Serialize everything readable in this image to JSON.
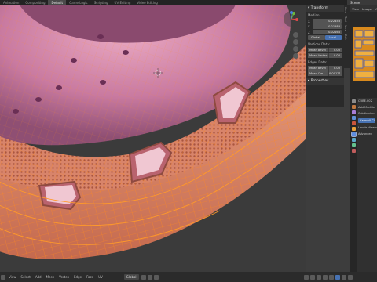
{
  "topbar": {
    "tabs": [
      "Animation",
      "Compositing",
      "Default",
      "Game Logic",
      "Scripting",
      "UV Editing",
      "Video Editing"
    ],
    "active_tab": "Default",
    "scene_label": "Scene"
  },
  "npanel": {
    "header": "Transform",
    "median_label": "Median:",
    "x_label": "X",
    "x_value": "0.22453",
    "y_label": "Y",
    "y_value": "0.21583",
    "z_label": "Z",
    "z_value": "0.02166",
    "space_global": "Global",
    "space_local": "Local",
    "vertices_data_label": "Vertices Data:",
    "mean_bevel_label": "Mean Bevel",
    "mean_bevel_value": "0.00",
    "mean_vertex_label": "Mean Vertex",
    "mean_vertex_value": "0.00",
    "edges_data_label": "Edges Data:",
    "edge_mean_bevel_label": "Mean Bevel",
    "edge_mean_bevel_value": "0.00",
    "mean_crease_label": "Mean Cre",
    "mean_crease_value": "0.00121",
    "properties_header": "Properties",
    "side_tabs": [
      "Item",
      "Tool",
      "View",
      "Edit"
    ]
  },
  "image_editor": {
    "menu_view": "View",
    "menu_image": "Image",
    "menu_uv": "UV"
  },
  "properties": {
    "object_name": "CUBE.002",
    "modifier_label": "Add Modifier",
    "subsurf_label": "Subdivision",
    "catmull_label": "Catmull-Clark",
    "levels_label": "Levels Viewport",
    "advanced_label": "Advanced"
  },
  "bottom": {
    "menus": [
      "View",
      "Select",
      "Add",
      "Mesh",
      "Vertex",
      "Edge",
      "Face",
      "UV"
    ],
    "orientation": "Global",
    "mode": "Edit Mode"
  },
  "colors": {
    "mesh_fill": "#d9917f",
    "wire": "#ff8a1f",
    "selected_face": "#f09a6a",
    "accent_blue": "#4772b3"
  }
}
